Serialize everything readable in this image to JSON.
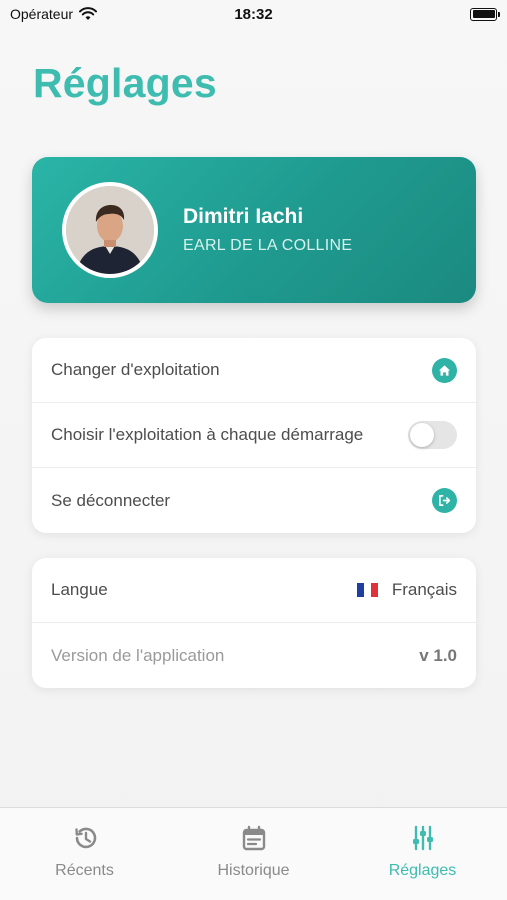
{
  "status_bar": {
    "carrier": "Opérateur",
    "time": "18:32"
  },
  "page_title": "Réglages",
  "profile": {
    "name": "Dimitri Iachi",
    "farm": "EARL DE LA COLLINE"
  },
  "settings": {
    "change_farm": "Changer d'exploitation",
    "choose_on_start": "Choisir l'exploitation à chaque démarrage",
    "choose_on_start_enabled": false,
    "logout": "Se déconnecter"
  },
  "app_info": {
    "language_label": "Langue",
    "language_value": "Français",
    "version_label": "Version de l'application",
    "version_value": "v 1.0"
  },
  "tabs": [
    {
      "label": "Récents",
      "icon": "history-icon",
      "active": false
    },
    {
      "label": "Historique",
      "icon": "calendar-icon",
      "active": false
    },
    {
      "label": "Réglages",
      "icon": "sliders-icon",
      "active": true
    }
  ],
  "colors": {
    "accent": "#3dbcaf",
    "card_gradient_start": "#2ab5a7",
    "card_gradient_end": "#1b8a80"
  }
}
